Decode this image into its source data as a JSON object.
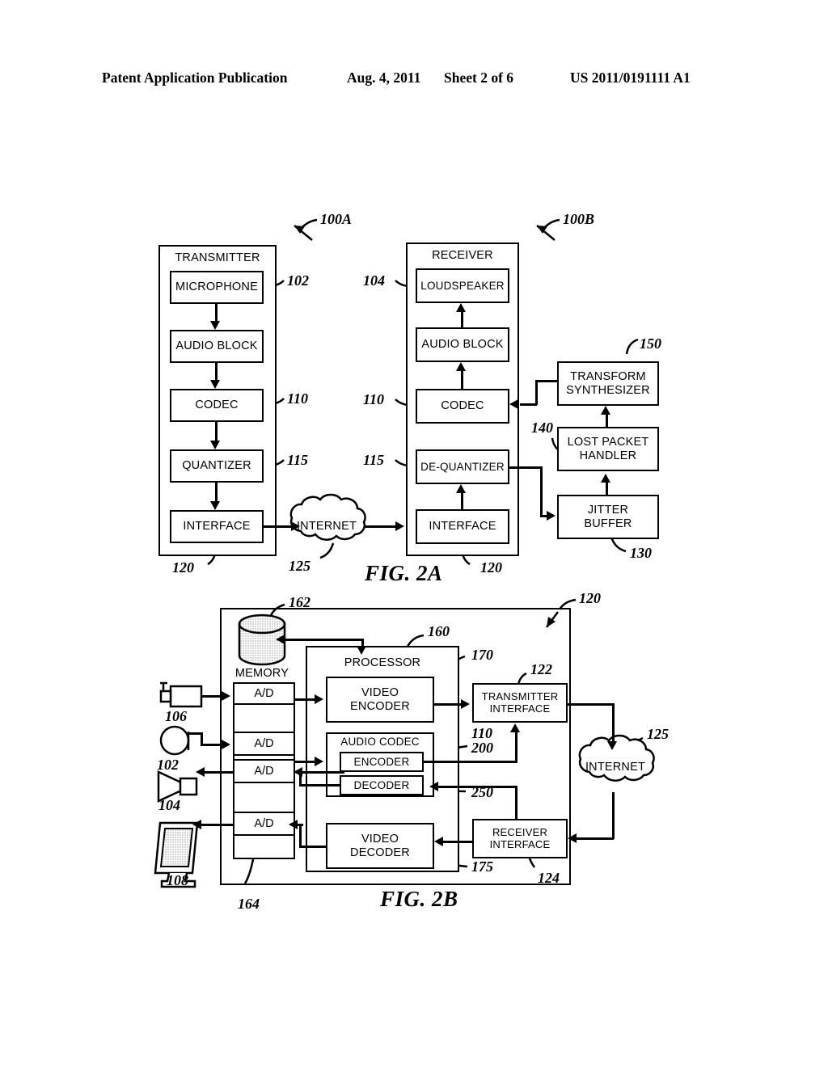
{
  "header": {
    "publication": "Patent Application Publication",
    "date": "Aug. 4, 2011",
    "sheet": "Sheet 2 of 6",
    "patent_number": "US 2011/0191111 A1"
  },
  "fig2a": {
    "label": "FIG. 2A",
    "transmitter": {
      "title": "TRANSMITTER",
      "system_ref": "100A",
      "outer_ref": "120",
      "blocks": [
        {
          "label": "MICROPHONE",
          "ref": "102"
        },
        {
          "label": "AUDIO BLOCK",
          "ref": ""
        },
        {
          "label": "CODEC",
          "ref": "110"
        },
        {
          "label": "QUANTIZER",
          "ref": "115"
        },
        {
          "label": "INTERFACE",
          "ref": ""
        }
      ]
    },
    "receiver": {
      "title": "RECEIVER",
      "system_ref": "100B",
      "outer_ref": "120",
      "blocks": [
        {
          "label": "LOUDSPEAKER",
          "ref": "104"
        },
        {
          "label": "AUDIO BLOCK",
          "ref": ""
        },
        {
          "label": "CODEC",
          "ref": "110"
        },
        {
          "label": "DE-QUANTIZER",
          "ref": "115"
        },
        {
          "label": "INTERFACE",
          "ref": ""
        }
      ]
    },
    "network": {
      "label": "INTERNET",
      "ref": "125"
    },
    "right_blocks": [
      {
        "label": "TRANSFORM\nSYNTHESIZER",
        "line1": "TRANSFORM",
        "line2": "SYNTHESIZER",
        "ref": "150"
      },
      {
        "label": "LOST PACKET\nHANDLER",
        "line1": "LOST PACKET",
        "line2": "HANDLER",
        "ref": "140"
      },
      {
        "label": "JITTER\nBUFFER",
        "line1": "JITTER",
        "line2": "BUFFER",
        "ref": "130"
      }
    ]
  },
  "fig2b": {
    "label": "FIG. 2B",
    "device_ref": "120",
    "memory": {
      "label": "MEMORY",
      "ref": "162"
    },
    "converters": {
      "label": "A/D",
      "ref": "164",
      "count": 4
    },
    "peripherals": [
      {
        "name": "camera",
        "ref": "106"
      },
      {
        "name": "microphone",
        "ref": "102"
      },
      {
        "name": "loudspeaker",
        "ref": "104"
      },
      {
        "name": "display",
        "ref": "108"
      }
    ],
    "processor": {
      "label": "PROCESSOR",
      "ref": "160"
    },
    "processor_blocks": [
      {
        "line1": "VIDEO",
        "line2": "ENCODER",
        "ref": "170"
      },
      {
        "line1": "VIDEO",
        "line2": "DECODER",
        "ref": "175"
      }
    ],
    "audio_codec": {
      "label": "AUDIO CODEC",
      "ref": "110",
      "encoder": {
        "label": "ENCODER",
        "ref": "200"
      },
      "decoder": {
        "label": "DECODER",
        "ref": "250"
      }
    },
    "interfaces": [
      {
        "line1": "TRANSMITTER",
        "line2": "INTERFACE",
        "ref": "122"
      },
      {
        "line1": "RECEIVER",
        "line2": "INTERFACE",
        "ref": "124"
      }
    ],
    "network": {
      "label": "INTERNET",
      "ref": "125"
    }
  }
}
